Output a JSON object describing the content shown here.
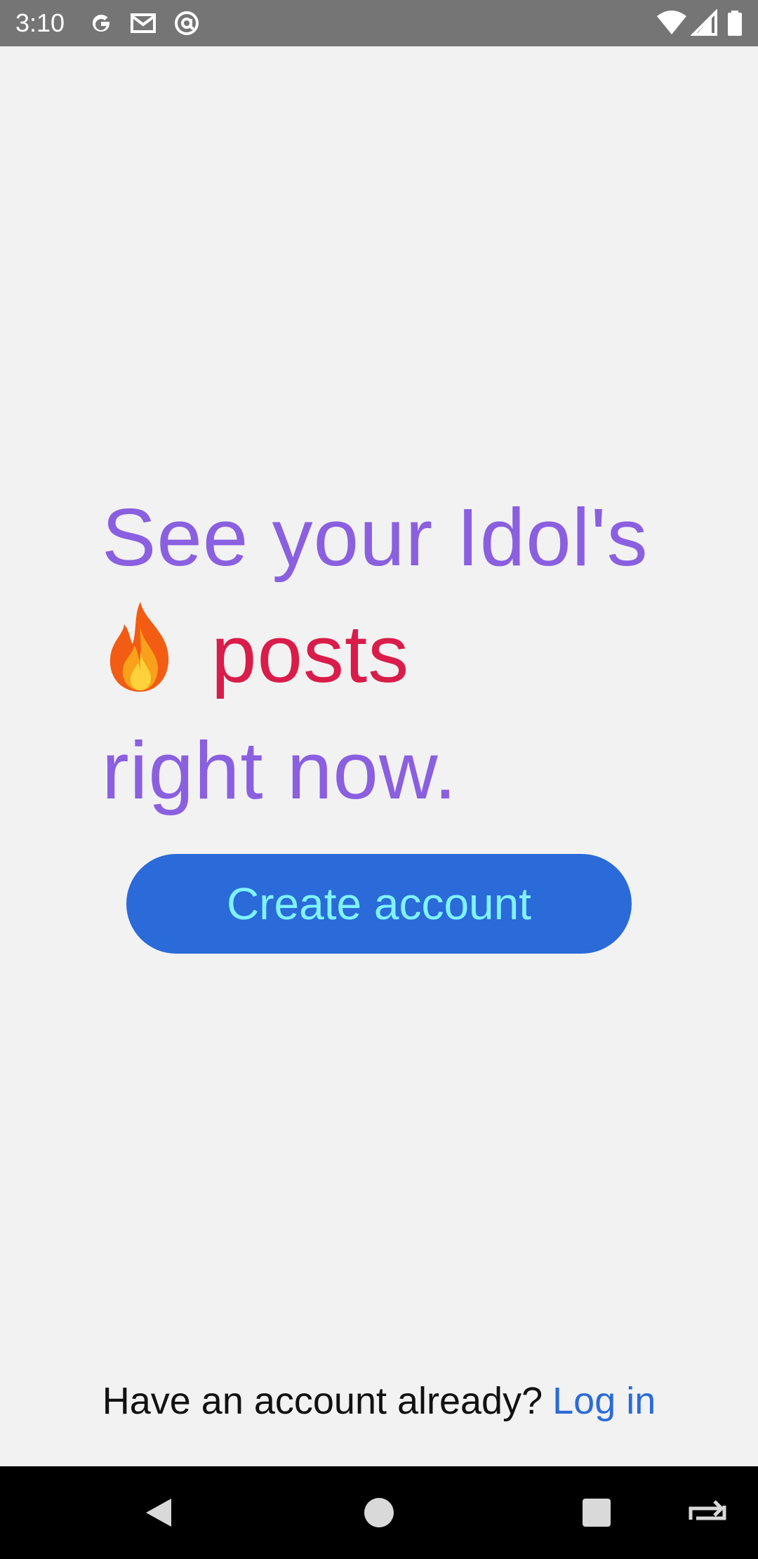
{
  "status_bar": {
    "time": "3:10",
    "left_icons": [
      "google-icon",
      "gmail-icon",
      "at-sign-icon"
    ],
    "right_icons": [
      "wifi-icon",
      "signal-icon",
      "battery-icon"
    ],
    "background": "#757575"
  },
  "headline": {
    "line1": "See your Idol's",
    "line2_icon": "fire-icon",
    "line2_word": "posts",
    "line3": "right now.",
    "color_primary": "#8a5fe0",
    "color_accent": "#d91c4a"
  },
  "create_button": {
    "label": "Create account",
    "background": "#2a6ad9",
    "text_color": "#7ff3ff"
  },
  "login": {
    "prompt": "Have an account already?",
    "link": "Log in",
    "link_color": "#2a6ad9"
  },
  "nav_bar": {
    "buttons": [
      "back-icon",
      "home-icon",
      "recents-icon",
      "rotate-icon"
    ]
  }
}
